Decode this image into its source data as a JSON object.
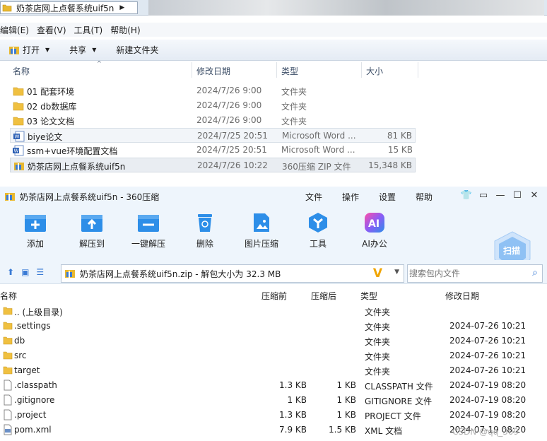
{
  "explorer": {
    "address_text": "奶茶店网上点餐系统uif5n",
    "menu": [
      "编辑(E)",
      "查看(V)",
      "工具(T)",
      "帮助(H)"
    ],
    "toolbar": {
      "open": "打开",
      "share": "共享",
      "new_folder": "新建文件夹"
    },
    "columns": {
      "name": "名称",
      "date": "修改日期",
      "type": "类型",
      "size": "大小"
    },
    "rows": [
      {
        "name": "01 配套环境",
        "date": "2024/7/26 9:00",
        "type": "文件夹",
        "size": "",
        "icon": "folder-icon"
      },
      {
        "name": "02 db数据库",
        "date": "2024/7/26 9:00",
        "type": "文件夹",
        "size": "",
        "icon": "folder-icon"
      },
      {
        "name": "03 论文文档",
        "date": "2024/7/26 9:00",
        "type": "文件夹",
        "size": "",
        "icon": "folder-icon"
      },
      {
        "name": "biye论文",
        "date": "2024/7/25 20:51",
        "type": "Microsoft Word ...",
        "size": "81 KB",
        "icon": "word-icon"
      },
      {
        "name": "ssm+vue环境配置文档",
        "date": "2024/7/25 20:51",
        "type": "Microsoft Word ...",
        "size": "15 KB",
        "icon": "word-icon"
      },
      {
        "name": "奶茶店网上点餐系统uif5n",
        "date": "2024/7/26 10:22",
        "type": "360压缩 ZIP 文件",
        "size": "15,348 KB",
        "icon": "zip-icon"
      }
    ]
  },
  "zip": {
    "title": "奶茶店网上点餐系统uif5n - 360压缩",
    "menu": [
      "文件",
      "操作",
      "设置",
      "帮助"
    ],
    "buttons": [
      "添加",
      "解压到",
      "一键解压",
      "删除",
      "图片压缩",
      "工具",
      "AI办公"
    ],
    "scan_label": "扫描",
    "path_text": "奶茶店网上点餐系统uif5n.zip - 解包大小为 32.3 MB",
    "search_placeholder": "搜索包内文件",
    "columns": {
      "name": "名称",
      "compressed_before": "压缩前",
      "compressed_after": "压缩后",
      "type": "类型",
      "date": "修改日期"
    },
    "rows": [
      {
        "name": ".. (上级目录)",
        "before": "",
        "after": "",
        "type": "文件夹",
        "date": "",
        "icon": "folder-icon"
      },
      {
        "name": ".settings",
        "before": "",
        "after": "",
        "type": "文件夹",
        "date": "2024-07-26 10:21",
        "icon": "folder-icon"
      },
      {
        "name": "db",
        "before": "",
        "after": "",
        "type": "文件夹",
        "date": "2024-07-26 10:21",
        "icon": "folder-icon"
      },
      {
        "name": "src",
        "before": "",
        "after": "",
        "type": "文件夹",
        "date": "2024-07-26 10:21",
        "icon": "folder-icon"
      },
      {
        "name": "target",
        "before": "",
        "after": "",
        "type": "文件夹",
        "date": "2024-07-26 10:21",
        "icon": "folder-icon"
      },
      {
        "name": ".classpath",
        "before": "1.3 KB",
        "after": "1 KB",
        "type": "CLASSPATH 文件",
        "date": "2024-07-19 08:20",
        "icon": "file-icon"
      },
      {
        "name": ".gitignore",
        "before": "1 KB",
        "after": "1 KB",
        "type": "GITIGNORE 文件",
        "date": "2024-07-19 08:20",
        "icon": "file-icon"
      },
      {
        "name": ".project",
        "before": "1.3 KB",
        "after": "1 KB",
        "type": "PROJECT 文件",
        "date": "2024-07-19 08:20",
        "icon": "file-icon"
      },
      {
        "name": "pom.xml",
        "before": "7.9 KB",
        "after": "1.5 KB",
        "type": "XML 文档",
        "date": "2024-07-19 08:20",
        "icon": "xml-icon"
      }
    ]
  },
  "watermark": "CSDN @qq_309"
}
